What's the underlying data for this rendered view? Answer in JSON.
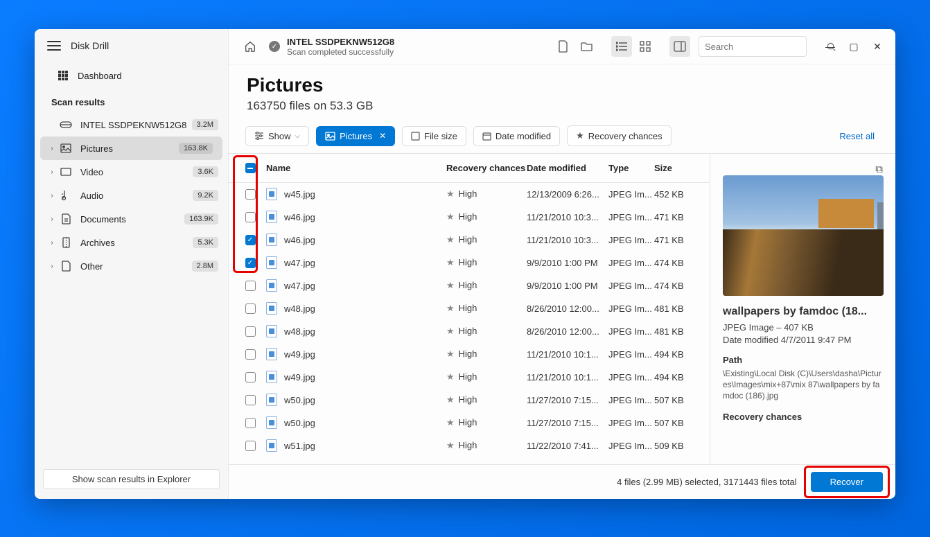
{
  "app": {
    "title": "Disk Drill"
  },
  "sidebar": {
    "dashboard": "Dashboard",
    "section_label": "Scan results",
    "items": [
      {
        "label": "INTEL SSDPEKNW512G8",
        "badge": "3.2M",
        "chev": ""
      },
      {
        "label": "Pictures",
        "badge": "163.8K",
        "chev": "›",
        "active": true
      },
      {
        "label": "Video",
        "badge": "3.6K",
        "chev": "›"
      },
      {
        "label": "Audio",
        "badge": "9.2K",
        "chev": "›"
      },
      {
        "label": "Documents",
        "badge": "163.9K",
        "chev": "›"
      },
      {
        "label": "Archives",
        "badge": "5.3K",
        "chev": "›"
      },
      {
        "label": "Other",
        "badge": "2.8M",
        "chev": "›"
      }
    ],
    "footer_btn": "Show scan results in Explorer"
  },
  "topbar": {
    "drive": "INTEL SSDPEKNW512G8",
    "status": "Scan completed successfully",
    "search_placeholder": "Search"
  },
  "page": {
    "title": "Pictures",
    "subtitle": "163750 files on 53.3 GB"
  },
  "filters": {
    "show": "Show",
    "pictures": "Pictures",
    "filesize": "File size",
    "date": "Date modified",
    "recovery": "Recovery chances",
    "reset": "Reset all"
  },
  "columns": {
    "name": "Name",
    "recovery": "Recovery chances",
    "date": "Date modified",
    "type": "Type",
    "size": "Size"
  },
  "rows": [
    {
      "chk": "off",
      "name": "w45.jpg",
      "rec": "High",
      "date": "12/13/2009 6:26...",
      "type": "JPEG Im...",
      "size": "452 KB"
    },
    {
      "chk": "off",
      "name": "w46.jpg",
      "rec": "High",
      "date": "11/21/2010 10:3...",
      "type": "JPEG Im...",
      "size": "471 KB"
    },
    {
      "chk": "on",
      "name": "w46.jpg",
      "rec": "High",
      "date": "11/21/2010 10:3...",
      "type": "JPEG Im...",
      "size": "471 KB"
    },
    {
      "chk": "on",
      "name": "w47.jpg",
      "rec": "High",
      "date": "9/9/2010 1:00 PM",
      "type": "JPEG Im...",
      "size": "474 KB"
    },
    {
      "chk": "off",
      "name": "w47.jpg",
      "rec": "High",
      "date": "9/9/2010 1:00 PM",
      "type": "JPEG Im...",
      "size": "474 KB"
    },
    {
      "chk": "off",
      "name": "w48.jpg",
      "rec": "High",
      "date": "8/26/2010 12:00...",
      "type": "JPEG Im...",
      "size": "481 KB"
    },
    {
      "chk": "off",
      "name": "w48.jpg",
      "rec": "High",
      "date": "8/26/2010 12:00...",
      "type": "JPEG Im...",
      "size": "481 KB"
    },
    {
      "chk": "off",
      "name": "w49.jpg",
      "rec": "High",
      "date": "11/21/2010 10:1...",
      "type": "JPEG Im...",
      "size": "494 KB"
    },
    {
      "chk": "off",
      "name": "w49.jpg",
      "rec": "High",
      "date": "11/21/2010 10:1...",
      "type": "JPEG Im...",
      "size": "494 KB"
    },
    {
      "chk": "off",
      "name": "w50.jpg",
      "rec": "High",
      "date": "11/27/2010 7:15...",
      "type": "JPEG Im...",
      "size": "507 KB"
    },
    {
      "chk": "off",
      "name": "w50.jpg",
      "rec": "High",
      "date": "11/27/2010 7:15...",
      "type": "JPEG Im...",
      "size": "507 KB"
    },
    {
      "chk": "off",
      "name": "w51.jpg",
      "rec": "High",
      "date": "11/22/2010 7:41...",
      "type": "JPEG Im...",
      "size": "509 KB"
    }
  ],
  "detail": {
    "title": "wallpapers by famdoc (18...",
    "type_size": "JPEG Image – 407 KB",
    "date": "Date modified 4/7/2011 9:47 PM",
    "path_label": "Path",
    "path": "\\Existing\\Local Disk (C)\\Users\\dasha\\Pictures\\Images\\mix+87\\mix 87\\wallpapers by famdoc (186).jpg",
    "rec_label": "Recovery chances"
  },
  "footer": {
    "status": "4 files (2.99 MB) selected, 3171443 files total",
    "recover": "Recover"
  }
}
